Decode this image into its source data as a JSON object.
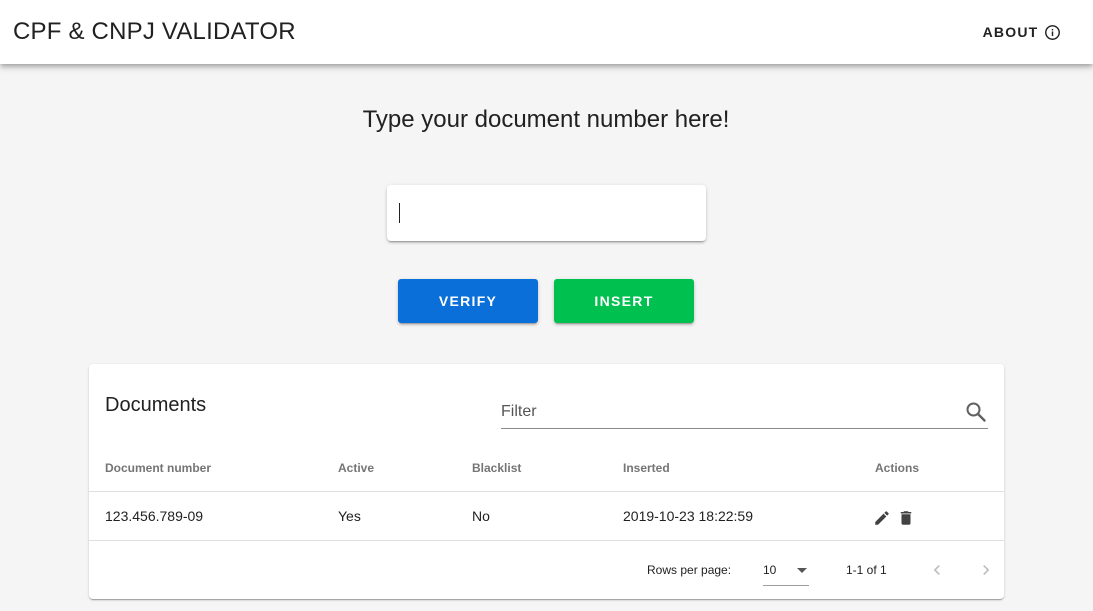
{
  "header": {
    "title_bold": "CPF & CNPJ",
    "title_light": "VALIDATOR",
    "about_label": "ABOUT",
    "about_icon": "info-icon"
  },
  "main": {
    "prompt": "Type your document number here!",
    "document_input": {
      "value": "",
      "placeholder": ""
    },
    "verify_label": "VERIFY",
    "insert_label": "INSERT",
    "colors": {
      "verify": "#0a6fd8",
      "insert": "#00c050"
    }
  },
  "documents": {
    "title": "Documents",
    "filter_placeholder": "Filter",
    "columns": [
      "Document number",
      "Active",
      "Blacklist",
      "Inserted",
      "Actions"
    ],
    "rows": [
      {
        "document_number": "123.456.789-09",
        "active": "Yes",
        "blacklist": "No",
        "inserted": "2019-10-23 18:22:59"
      }
    ],
    "footer": {
      "rows_per_page_label": "Rows per page:",
      "rows_per_page_value": "10",
      "range": "1-1 of 1"
    }
  }
}
